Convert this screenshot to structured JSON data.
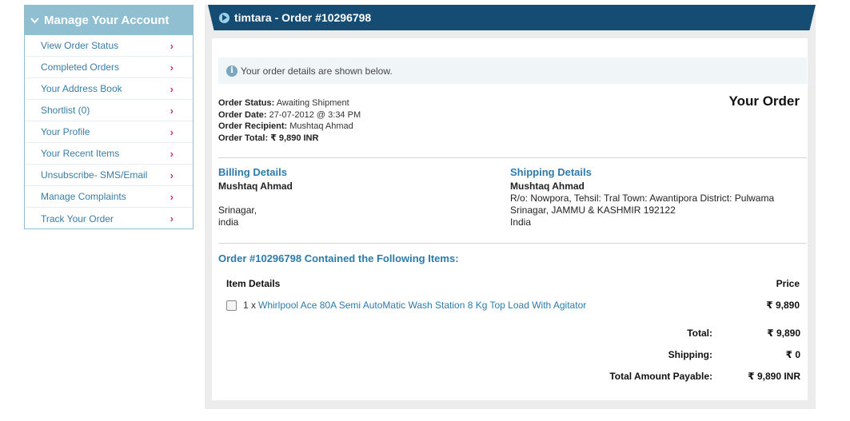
{
  "sidebar": {
    "title": "Manage Your Account",
    "items": [
      {
        "label": "View Order Status"
      },
      {
        "label": "Completed Orders"
      },
      {
        "label": "Your Address Book"
      },
      {
        "label": "Shortlist (0)"
      },
      {
        "label": "Your Profile"
      },
      {
        "label": "Your Recent Items"
      },
      {
        "label": "Unsubscribe- SMS/Email"
      },
      {
        "label": "Manage Complaints"
      },
      {
        "label": "Track Your Order"
      }
    ],
    "arrow": "›"
  },
  "header": {
    "title": "timtara - Order #10296798"
  },
  "info": {
    "message": "Your order details are shown below."
  },
  "order": {
    "heading": "Your Order",
    "status_label": "Order Status:",
    "status": "Awaiting Shipment",
    "date_label": "Order Date:",
    "date": "27-07-2012 @ 3:34 PM",
    "recipient_label": "Order Recipient:",
    "recipient": "Mushtaq Ahmad",
    "total_label": "Order Total:",
    "total": "₹ 9,890 INR"
  },
  "billing": {
    "title": "Billing Details",
    "name": "Mushtaq Ahmad",
    "line1": "",
    "city": "Srinagar,",
    "country": "india"
  },
  "shipping": {
    "title": "Shipping Details",
    "name": "Mushtaq Ahmad",
    "line1": "R/o: Nowpora, Tehsil: Tral Town: Awantipora District: Pulwama",
    "line2": "Srinagar, JAMMU & KASHMIR 192122",
    "country": "India"
  },
  "items": {
    "title": "Order #10296798 Contained the Following Items:",
    "col_details": "Item Details",
    "col_price": "Price",
    "rows": [
      {
        "qty": "1 x",
        "name": "Whirlpool Ace 80A Semi AutoMatic Wash Station 8 Kg Top Load With Agitator",
        "price": "₹ 9,890"
      }
    ]
  },
  "totals": {
    "total_label": "Total:",
    "total": "₹ 9,890",
    "shipping_label": "Shipping:",
    "shipping": "₹ 0",
    "payable_label": "Total Amount Payable:",
    "payable": "₹ 9,890 INR"
  },
  "colors": {
    "header_bg": "#144c73",
    "sidebar_header_bg": "#8fbfd1",
    "link": "#2d7bab",
    "arrow": "#d6336c"
  }
}
